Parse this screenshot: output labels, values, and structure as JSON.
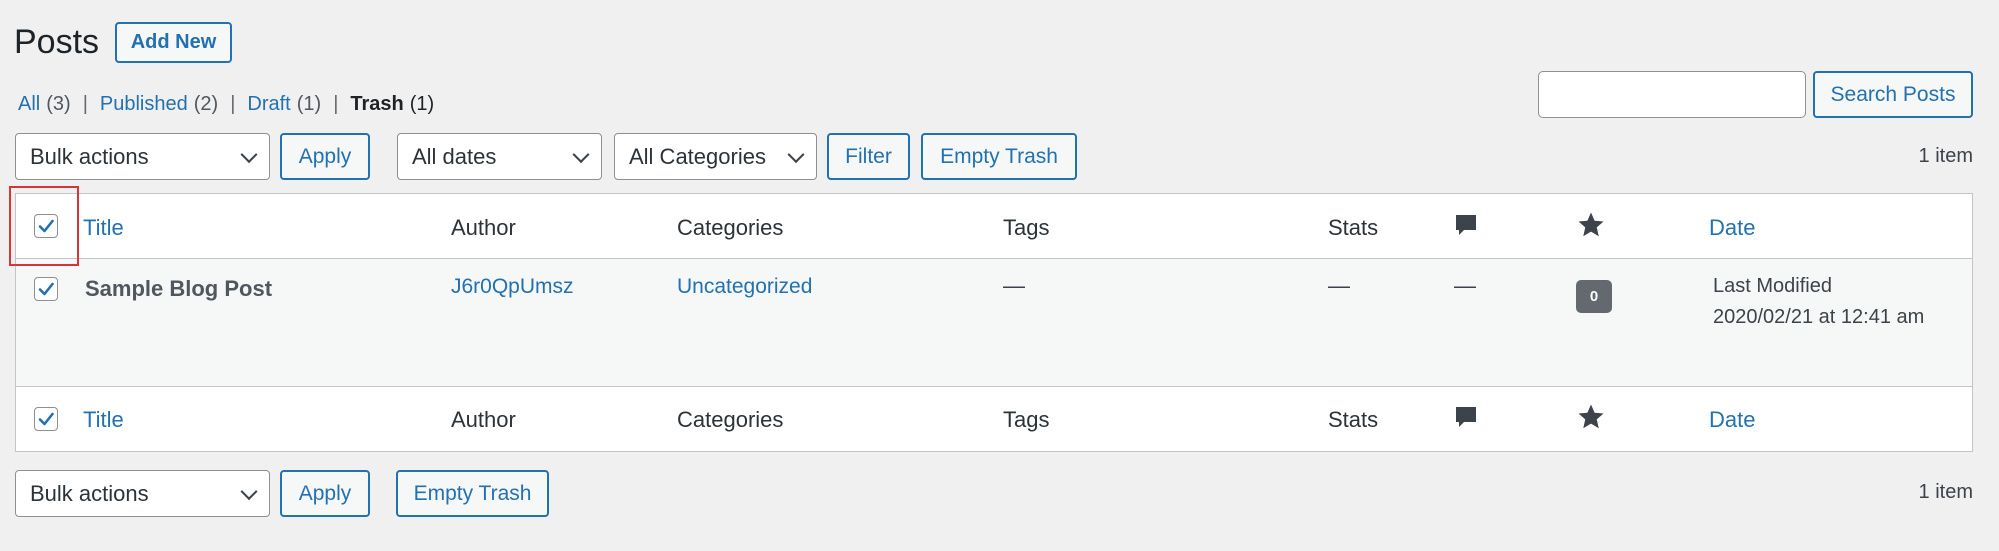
{
  "page": {
    "title": "Posts",
    "add_new_label": "Add New"
  },
  "views": [
    {
      "label": "All",
      "count": "(3)"
    },
    {
      "label": "Published",
      "count": "(2)"
    },
    {
      "label": "Draft",
      "count": "(1)"
    },
    {
      "label": "Trash",
      "count": "(1)",
      "current": true
    }
  ],
  "search": {
    "value": "",
    "placeholder": "",
    "button_label": "Search Posts"
  },
  "top_nav": {
    "bulk_actions": "Bulk actions",
    "apply_label": "Apply",
    "date_filter": "All dates",
    "category_filter": "All Categories",
    "filter_label": "Filter",
    "empty_trash_label": "Empty Trash",
    "items_count": "1 item"
  },
  "table": {
    "columns": {
      "title": "Title",
      "author": "Author",
      "categories": "Categories",
      "tags": "Tags",
      "stats": "Stats",
      "comments_icon": "comment-bubble-icon",
      "rating_icon": "star-icon",
      "date": "Date"
    },
    "rows": [
      {
        "checked": true,
        "title": "Sample Blog Post",
        "author": "J6r0QpUmsz",
        "categories": "Uncategorized",
        "tags": "—",
        "stats": "—",
        "comments": "—",
        "rating_badge": "0",
        "date_status": "Last Modified",
        "date_value": "2020/02/21 at 12:41 am"
      }
    ],
    "select_all_checked": true
  },
  "bottom_nav": {
    "bulk_actions": "Bulk actions",
    "apply_label": "Apply",
    "empty_trash_label": "Empty Trash",
    "items_count": "1 item"
  },
  "colors": {
    "link": "#2271b1",
    "background": "#f0f0f1",
    "focus_outline": "#d63638"
  }
}
